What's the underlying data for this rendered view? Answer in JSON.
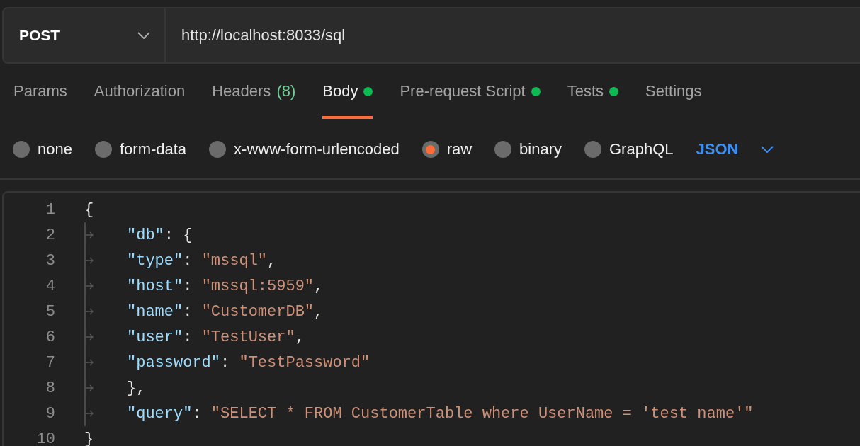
{
  "request": {
    "method": "POST",
    "url": "http://localhost:8033/sql"
  },
  "tabs": [
    {
      "label": "Params",
      "selected": false,
      "dot": false
    },
    {
      "label": "Authorization",
      "selected": false,
      "dot": false
    },
    {
      "label": "Headers",
      "count": "(8)",
      "selected": false,
      "dot": false
    },
    {
      "label": "Body",
      "selected": true,
      "dot": true
    },
    {
      "label": "Pre-request Script",
      "selected": false,
      "dot": true
    },
    {
      "label": "Tests",
      "selected": false,
      "dot": true
    },
    {
      "label": "Settings",
      "selected": false,
      "dot": false
    }
  ],
  "body_types": [
    {
      "label": "none",
      "selected": false
    },
    {
      "label": "form-data",
      "selected": false
    },
    {
      "label": "x-www-form-urlencoded",
      "selected": false
    },
    {
      "label": "raw",
      "selected": true
    },
    {
      "label": "binary",
      "selected": false
    },
    {
      "label": "GraphQL",
      "selected": false
    }
  ],
  "format": "JSON",
  "code_lines": [
    {
      "number": "1",
      "indent": false,
      "tokens": [
        {
          "kind": "punct",
          "text": "{"
        }
      ]
    },
    {
      "number": "2",
      "indent": true,
      "tokens": [
        {
          "kind": "key",
          "text": "\"db\""
        },
        {
          "kind": "punct",
          "text": ": {"
        }
      ]
    },
    {
      "number": "3",
      "indent": true,
      "tokens": [
        {
          "kind": "key",
          "text": "\"type\""
        },
        {
          "kind": "punct",
          "text": ": "
        },
        {
          "kind": "string",
          "text": "\"mssql\""
        },
        {
          "kind": "punct",
          "text": ","
        }
      ]
    },
    {
      "number": "4",
      "indent": true,
      "tokens": [
        {
          "kind": "key",
          "text": "\"host\""
        },
        {
          "kind": "punct",
          "text": ": "
        },
        {
          "kind": "string",
          "text": "\"mssql:5959\""
        },
        {
          "kind": "punct",
          "text": ","
        }
      ]
    },
    {
      "number": "5",
      "indent": true,
      "tokens": [
        {
          "kind": "key",
          "text": "\"name\""
        },
        {
          "kind": "punct",
          "text": ": "
        },
        {
          "kind": "string",
          "text": "\"CustomerDB\""
        },
        {
          "kind": "punct",
          "text": ","
        }
      ]
    },
    {
      "number": "6",
      "indent": true,
      "tokens": [
        {
          "kind": "key",
          "text": "\"user\""
        },
        {
          "kind": "punct",
          "text": ": "
        },
        {
          "kind": "string",
          "text": "\"TestUser\""
        },
        {
          "kind": "punct",
          "text": ","
        }
      ]
    },
    {
      "number": "7",
      "indent": true,
      "tokens": [
        {
          "kind": "key",
          "text": "\"password\""
        },
        {
          "kind": "punct",
          "text": ": "
        },
        {
          "kind": "string",
          "text": "\"TestPassword\""
        }
      ]
    },
    {
      "number": "8",
      "indent": true,
      "tokens": [
        {
          "kind": "punct",
          "text": "},"
        }
      ]
    },
    {
      "number": "9",
      "indent": true,
      "tokens": [
        {
          "kind": "key",
          "text": "\"query\""
        },
        {
          "kind": "punct",
          "text": ": "
        },
        {
          "kind": "string",
          "text": "\"SELECT * FROM CustomerTable where UserName = 'test name'\""
        }
      ]
    },
    {
      "number": "10",
      "indent": false,
      "tokens": [
        {
          "kind": "punct",
          "text": "}"
        }
      ]
    }
  ]
}
